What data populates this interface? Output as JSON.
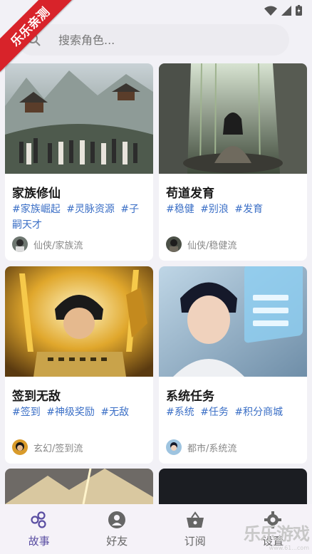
{
  "ribbon": {
    "text": "乐乐亲测"
  },
  "search": {
    "placeholder": "搜索角色..."
  },
  "cards": [
    {
      "title": "家族修仙",
      "tags": [
        "#家族崛起",
        "#灵脉资源",
        "#子嗣天才"
      ],
      "meta": "仙侠/家族流"
    },
    {
      "title": "苟道发育",
      "tags": [
        "#稳健",
        "#别浪",
        "#发育"
      ],
      "meta": "仙侠/稳健流"
    },
    {
      "title": "签到无敌",
      "tags": [
        "#签到",
        "#神级奖励",
        "#无敌"
      ],
      "meta": "玄幻/签到流"
    },
    {
      "title": "系统任务",
      "tags": [
        "#系统",
        "#任务",
        "#积分商城"
      ],
      "meta": "都市/系统流"
    }
  ],
  "tabs": [
    {
      "label": "故事",
      "icon": "story-icon",
      "active": true
    },
    {
      "label": "好友",
      "icon": "person-icon",
      "active": false
    },
    {
      "label": "订阅",
      "icon": "basket-icon",
      "active": false
    },
    {
      "label": "设置",
      "icon": "gear-icon",
      "active": false
    }
  ],
  "watermark": {
    "text": "乐乐游戏",
    "sub": "www.61...com"
  },
  "colors": {
    "accent": "#5a4ea2",
    "tag": "#3b6fc6",
    "ribbon": "#d8232a"
  }
}
